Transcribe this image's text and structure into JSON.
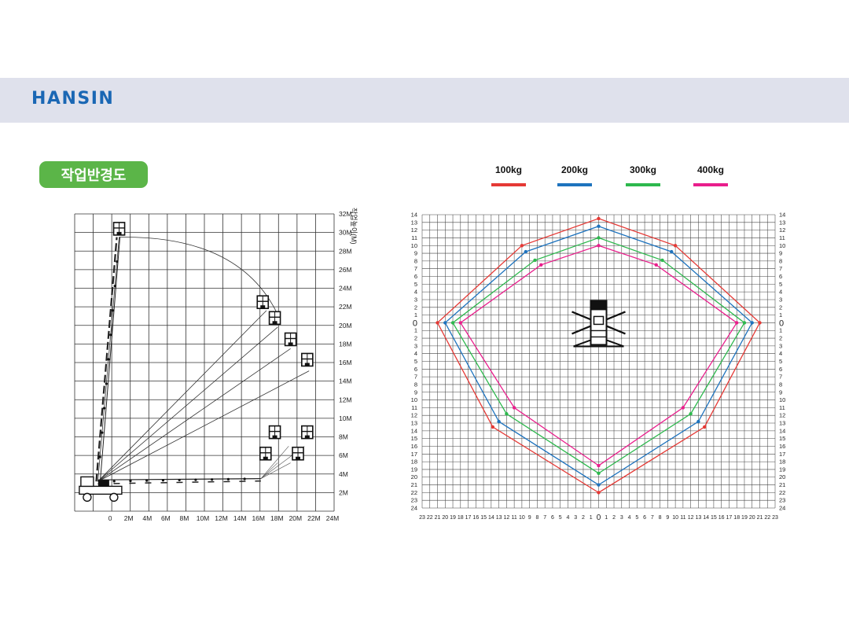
{
  "header": {
    "logo": "HANSIN"
  },
  "section": {
    "badge": "작업반경도"
  },
  "legend": [
    {
      "label": "100kg",
      "color": "#e53935"
    },
    {
      "label": "200kg",
      "color": "#1e73be"
    },
    {
      "label": "300kg",
      "color": "#2db84d"
    },
    {
      "label": "400kg",
      "color": "#e91e8c"
    }
  ],
  "side_chart": {
    "y_title": "작업높이(M)",
    "y_labels": [
      "2M",
      "4M",
      "6M",
      "8M",
      "10M",
      "12M",
      "14M",
      "16M",
      "18M",
      "20M",
      "22M",
      "24M",
      "26M",
      "28M",
      "30M",
      "32M"
    ],
    "x_labels": [
      "0",
      "2M",
      "4M",
      "6M",
      "8M",
      "10M",
      "12M",
      "14M",
      "16M",
      "18M",
      "20M",
      "22M",
      "24M"
    ]
  },
  "chart_data": {
    "type": "scatter",
    "description_axis": "horizontal reach envelope (m) by basket load",
    "x_ticks_left": [
      23,
      22,
      21,
      20,
      19,
      18,
      17,
      16,
      15,
      14,
      13,
      12,
      11,
      10,
      9,
      8,
      7,
      6,
      5,
      4,
      3,
      2,
      1
    ],
    "x_ticks_right": [
      1,
      2,
      3,
      4,
      5,
      6,
      7,
      8,
      9,
      10,
      11,
      12,
      13,
      14,
      15,
      16,
      17,
      18,
      19,
      20,
      21,
      22,
      23
    ],
    "y_ticks_up": [
      14,
      13,
      12,
      11,
      10,
      9,
      8,
      7,
      6,
      5,
      4,
      3,
      2,
      1
    ],
    "y_ticks_down": [
      1,
      2,
      3,
      4,
      5,
      6,
      7,
      8,
      9,
      10,
      11,
      12,
      13,
      14,
      15,
      16,
      17,
      18,
      19,
      20,
      21,
      22,
      23,
      24
    ],
    "zero_label": "0",
    "xlim": [
      -23,
      23
    ],
    "ylim": [
      -24,
      14
    ],
    "series": [
      {
        "name": "100kg",
        "color": "#e53935",
        "points": [
          [
            0,
            13.5
          ],
          [
            10,
            10
          ],
          [
            21,
            0
          ],
          [
            13.8,
            -13.5
          ],
          [
            0,
            -22
          ],
          [
            -13.8,
            -13.5
          ],
          [
            -21,
            0
          ],
          [
            -10,
            10
          ]
        ]
      },
      {
        "name": "200kg",
        "color": "#1e73be",
        "points": [
          [
            0,
            12.5
          ],
          [
            9.5,
            9.2
          ],
          [
            20,
            0
          ],
          [
            13,
            -12.8
          ],
          [
            0,
            -21
          ],
          [
            -13,
            -12.8
          ],
          [
            -20,
            0
          ],
          [
            -9.5,
            9.2
          ]
        ]
      },
      {
        "name": "300kg",
        "color": "#2db84d",
        "points": [
          [
            0,
            11
          ],
          [
            8.3,
            8.1
          ],
          [
            19,
            0
          ],
          [
            12,
            -11.8
          ],
          [
            0,
            -19.5
          ],
          [
            -12,
            -11.8
          ],
          [
            -19,
            0
          ],
          [
            -8.3,
            8.1
          ]
        ]
      },
      {
        "name": "400kg",
        "color": "#e91e8c",
        "points": [
          [
            0,
            10
          ],
          [
            7.5,
            7.5
          ],
          [
            18,
            0
          ],
          [
            11,
            -11
          ],
          [
            0,
            -18.5
          ],
          [
            -11,
            -11
          ],
          [
            -18,
            0
          ],
          [
            -7.5,
            7.5
          ]
        ]
      }
    ]
  }
}
